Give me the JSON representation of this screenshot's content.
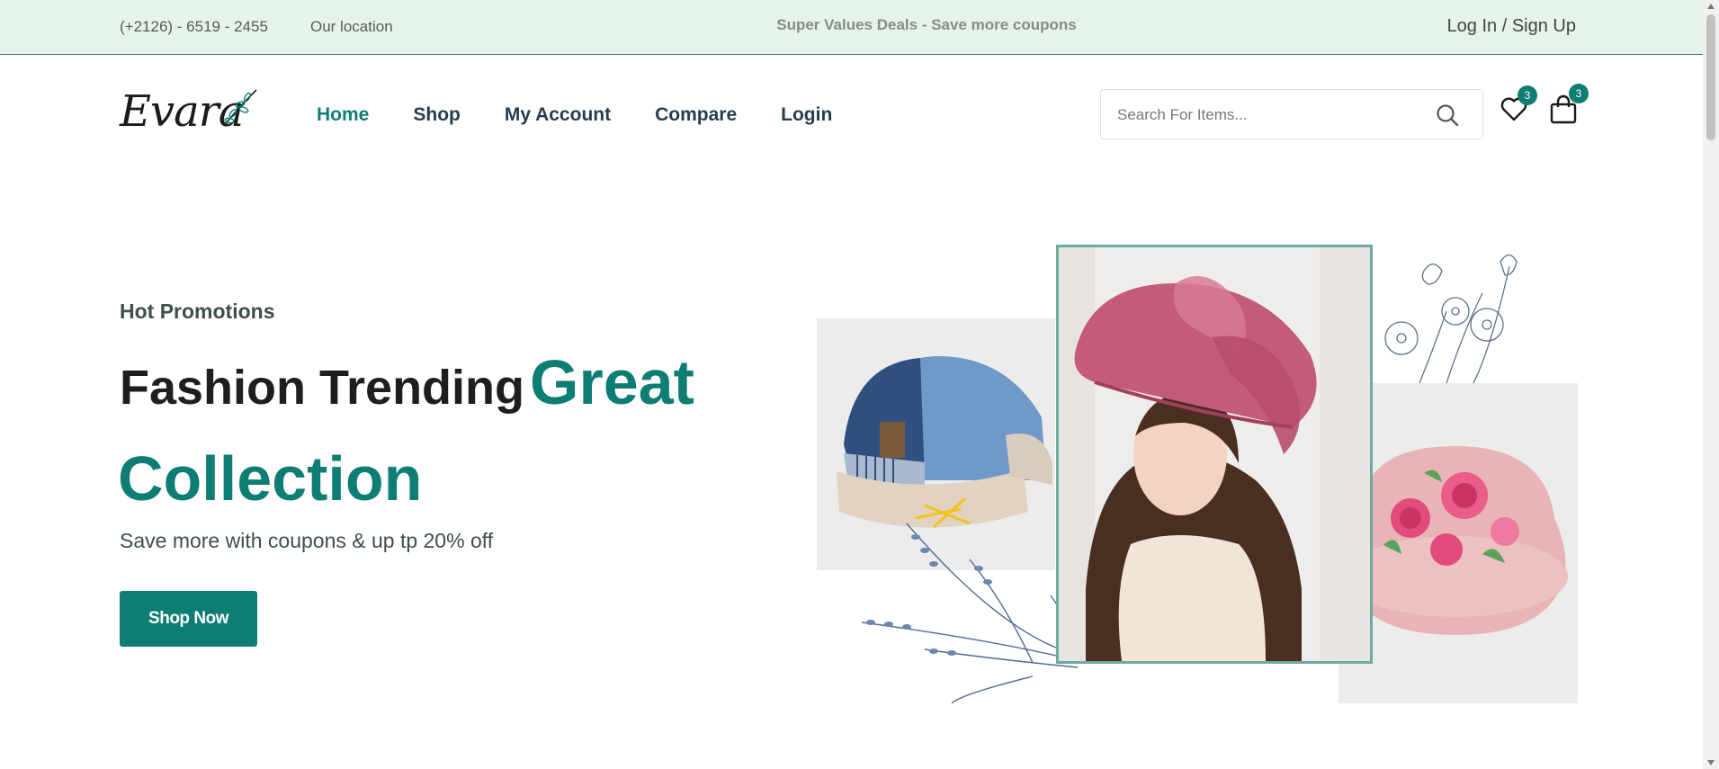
{
  "topbar": {
    "phone": "(+2126) - 6519 - 2455",
    "location": "Our location",
    "deals": "Super Values Deals - Save more coupons",
    "auth": "Log In / Sign Up"
  },
  "header": {
    "logo": "Evara",
    "nav": [
      "Home",
      "Shop",
      "My Account",
      "Compare",
      "Login"
    ],
    "active_nav": "Home",
    "search_placeholder": "Search For Items...",
    "wishlist_count": "3",
    "cart_count": "3"
  },
  "hero": {
    "subtitle": "Hot Promotions",
    "title_plain": "Fashion Trending",
    "title_accent_1": "Great",
    "title_accent_2": "Collection",
    "description": "Save more with coupons & up tp 20% off",
    "button": "Shop Now"
  },
  "colors": {
    "accent": "#0e7d73",
    "topbar_bg": "#e5f3ea",
    "panel_bg": "#ececec"
  },
  "icons": [
    "search-icon",
    "heart-icon",
    "shopping-bag-icon",
    "leaf-sprig-icon"
  ]
}
